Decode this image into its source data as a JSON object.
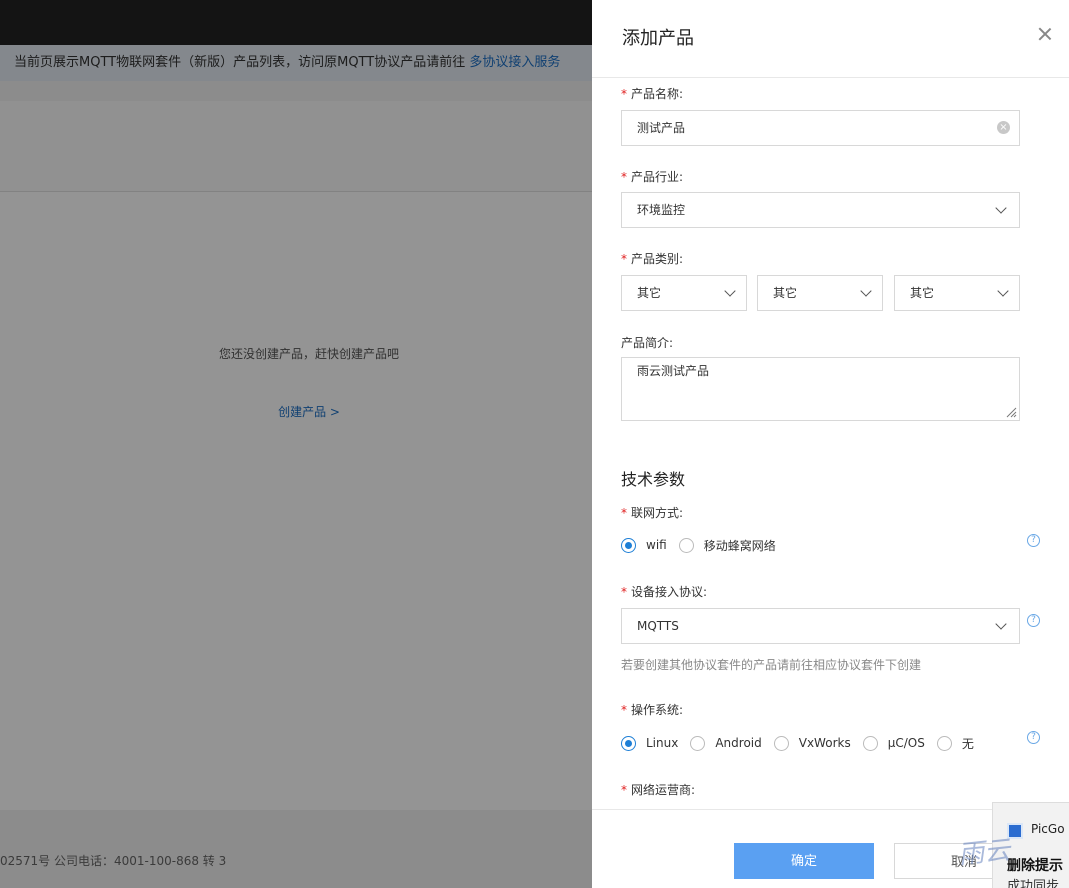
{
  "background": {
    "notice_text": "当前页展示MQTT物联网套件（新版）产品列表，访问原MQTT协议产品请前往 ",
    "notice_link": "多协议接入服务",
    "empty_text": "您还没创建产品，赶快创建产品吧",
    "create_link": "创建产品 >",
    "footer_text": "02571号 公司电话：4001-100-868 转 3"
  },
  "drawer": {
    "title": "添加产品",
    "required_mark": "*",
    "product_name": {
      "label": "产品名称:",
      "value": "测试产品"
    },
    "industry": {
      "label": "产品行业:",
      "value": "环境监控"
    },
    "category": {
      "label": "产品类别:",
      "values": [
        "其它",
        "其它",
        "其它"
      ]
    },
    "description": {
      "label": "产品简介:",
      "value": "雨云测试产品"
    },
    "tech_section": "技术参数",
    "network": {
      "label": "联网方式:",
      "options": [
        "wifi",
        "移动蜂窝网络"
      ],
      "selected": "wifi"
    },
    "protocol": {
      "label": "设备接入协议:",
      "value": "MQTTS",
      "hint": "若要创建其他协议套件的产品请前往相应协议套件下创建"
    },
    "os": {
      "label": "操作系统:",
      "options": [
        "Linux",
        "Android",
        "VxWorks",
        "μC/OS",
        "无"
      ],
      "selected": "Linux"
    },
    "carrier": {
      "label": "网络运营商:"
    },
    "help_glyph": "?",
    "ok_label": "确定",
    "cancel_label": "取消"
  },
  "toast": {
    "app": "PicGo",
    "title": "删除提示",
    "body": "成功同步"
  },
  "watermark": "雨云"
}
